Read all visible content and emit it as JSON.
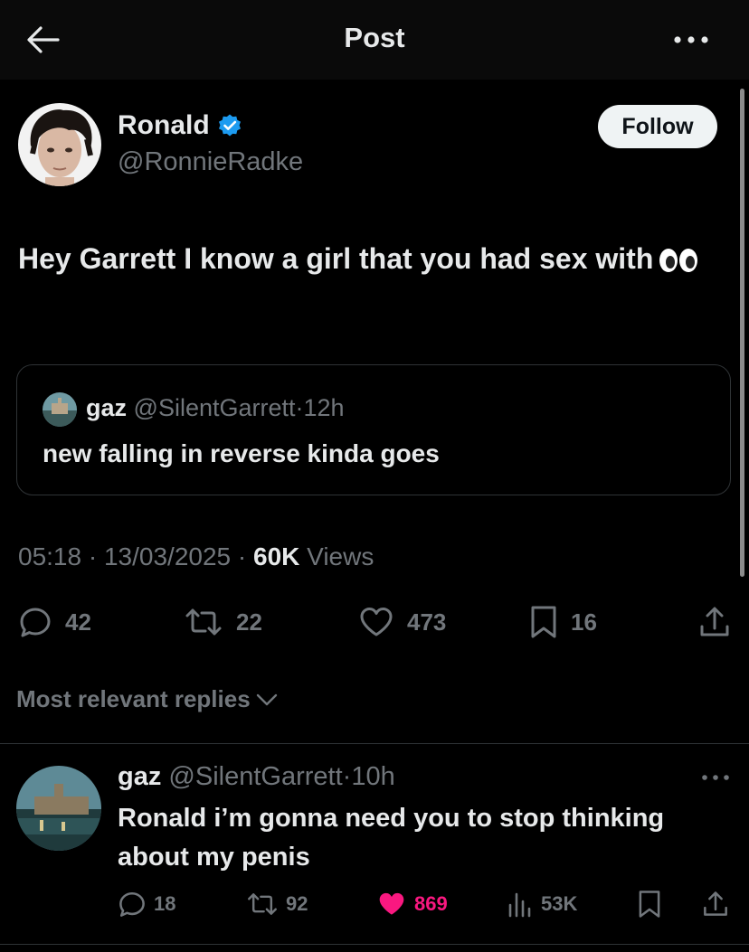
{
  "header": {
    "title": "Post",
    "back_icon": "arrow-left-icon",
    "more_icon": "more-horizontal-icon"
  },
  "author": {
    "name": "Ronald",
    "handle": "@RonnieRadke",
    "verified": true,
    "verified_color": "#1d9bf0"
  },
  "follow_label": "Follow",
  "post": {
    "text": "Hey Garrett I know a girl that you had sex with",
    "emoji": "eyes-emoji"
  },
  "quote": {
    "name": "gaz",
    "handle": "@SilentGarrett",
    "sep": "·",
    "time": "12h",
    "text": "new falling in reverse kinda goes"
  },
  "meta": {
    "time": "05:18",
    "dot1": "·",
    "date": "13/03/2025",
    "dot2": "·",
    "views_count": "60K",
    "views_label": "Views"
  },
  "actions": {
    "replies": "42",
    "reposts": "22",
    "likes": "473",
    "bookmarks": "16"
  },
  "relevance_label": "Most relevant replies",
  "reply": {
    "name": "gaz",
    "handle": "@SilentGarrett",
    "sep": "·",
    "time": "10h",
    "text": "Ronald i’m gonna need you to stop thinking about my penis",
    "replies": "18",
    "reposts": "92",
    "likes": "869",
    "views": "53K",
    "liked": true,
    "like_color": "#f91880"
  }
}
